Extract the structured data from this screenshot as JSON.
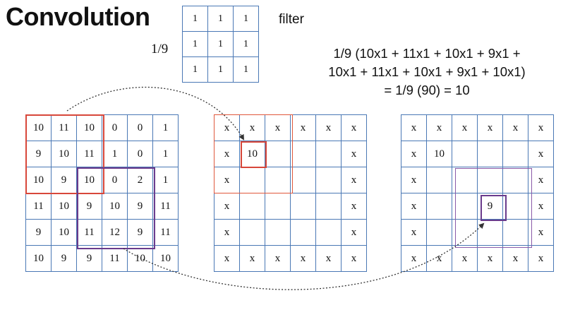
{
  "title": "Convolution",
  "filter": {
    "scale_label": "1/9",
    "caption": "filter",
    "rows": [
      [
        "1",
        "1",
        "1"
      ],
      [
        "1",
        "1",
        "1"
      ],
      [
        "1",
        "1",
        "1"
      ]
    ]
  },
  "formula": {
    "line1": "1/9 (10x1 + 11x1 + 10x1 + 9x1 +",
    "line2": "10x1 + 11x1 + 10x1 + 9x1 + 10x1)",
    "line3": "= 1/9 (90) = 10"
  },
  "input_grid": {
    "rows": [
      [
        "10",
        "11",
        "10",
        "0",
        "0",
        "1"
      ],
      [
        "9",
        "10",
        "11",
        "1",
        "0",
        "1"
      ],
      [
        "10",
        "9",
        "10",
        "0",
        "2",
        "1"
      ],
      [
        "11",
        "10",
        "9",
        "10",
        "9",
        "11"
      ],
      [
        "9",
        "10",
        "11",
        "12",
        "9",
        "11"
      ],
      [
        "10",
        "9",
        "9",
        "11",
        "10",
        "10"
      ]
    ]
  },
  "output_grid_1": {
    "rows": [
      [
        "x",
        "x",
        "x",
        "x",
        "x",
        "x"
      ],
      [
        "x",
        "10",
        "",
        "",
        "",
        "x"
      ],
      [
        "x",
        "",
        "",
        "",
        "",
        "x"
      ],
      [
        "x",
        "",
        "",
        "",
        "",
        "x"
      ],
      [
        "x",
        "",
        "",
        "",
        "",
        "x"
      ],
      [
        "x",
        "x",
        "x",
        "x",
        "x",
        "x"
      ]
    ]
  },
  "output_grid_2": {
    "rows": [
      [
        "x",
        "x",
        "x",
        "x",
        "x",
        "x"
      ],
      [
        "x",
        "10",
        "",
        "",
        "",
        "x"
      ],
      [
        "x",
        "",
        "",
        "",
        "",
        "x"
      ],
      [
        "x",
        "",
        "",
        "9",
        "",
        "x"
      ],
      [
        "x",
        "",
        "",
        "",
        "",
        "x"
      ],
      [
        "x",
        "x",
        "x",
        "x",
        "x",
        "x"
      ]
    ]
  },
  "colors": {
    "grid_line": "#4a78b5",
    "first_window": "#d8473a",
    "second_window": "#6a3b8c",
    "arrow": "#333333"
  }
}
